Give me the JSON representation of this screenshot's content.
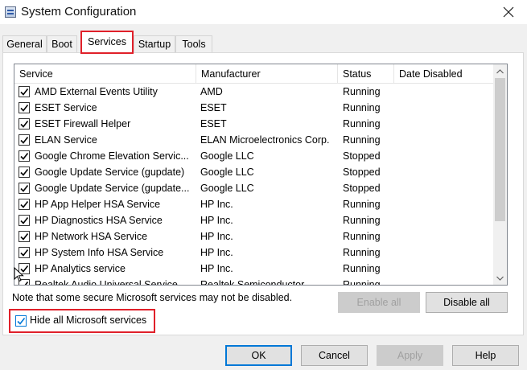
{
  "window": {
    "title": "System Configuration"
  },
  "tabs": [
    {
      "label": "General"
    },
    {
      "label": "Boot"
    },
    {
      "label": "Services"
    },
    {
      "label": "Startup"
    },
    {
      "label": "Tools"
    }
  ],
  "active_tab": "Services",
  "table": {
    "columns": [
      "Service",
      "Manufacturer",
      "Status",
      "Date Disabled"
    ],
    "rows": [
      {
        "checked": true,
        "service": "AMD External Events Utility",
        "manufacturer": "AMD",
        "status": "Running",
        "date_disabled": ""
      },
      {
        "checked": true,
        "service": "ESET Service",
        "manufacturer": "ESET",
        "status": "Running",
        "date_disabled": ""
      },
      {
        "checked": true,
        "service": "ESET Firewall Helper",
        "manufacturer": "ESET",
        "status": "Running",
        "date_disabled": ""
      },
      {
        "checked": true,
        "service": "ELAN Service",
        "manufacturer": "ELAN Microelectronics Corp.",
        "status": "Running",
        "date_disabled": ""
      },
      {
        "checked": true,
        "service": "Google Chrome Elevation Servic...",
        "manufacturer": "Google LLC",
        "status": "Stopped",
        "date_disabled": ""
      },
      {
        "checked": true,
        "service": "Google Update Service (gupdate)",
        "manufacturer": "Google LLC",
        "status": "Stopped",
        "date_disabled": ""
      },
      {
        "checked": true,
        "service": "Google Update Service (gupdate...",
        "manufacturer": "Google LLC",
        "status": "Stopped",
        "date_disabled": ""
      },
      {
        "checked": true,
        "service": "HP App Helper HSA Service",
        "manufacturer": "HP Inc.",
        "status": "Running",
        "date_disabled": ""
      },
      {
        "checked": true,
        "service": "HP Diagnostics HSA Service",
        "manufacturer": "HP Inc.",
        "status": "Running",
        "date_disabled": ""
      },
      {
        "checked": true,
        "service": "HP Network HSA Service",
        "manufacturer": "HP Inc.",
        "status": "Running",
        "date_disabled": ""
      },
      {
        "checked": true,
        "service": "HP System Info HSA Service",
        "manufacturer": "HP Inc.",
        "status": "Running",
        "date_disabled": ""
      },
      {
        "checked": true,
        "service": "HP Analytics service",
        "manufacturer": "HP Inc.",
        "status": "Running",
        "date_disabled": ""
      },
      {
        "checked": true,
        "service": "Realtek Audio Universal Service",
        "manufacturer": "Realtek Semiconductor",
        "status": "Running",
        "date_disabled": ""
      }
    ]
  },
  "note": "Note that some secure Microsoft services may not be disabled.",
  "buttons": {
    "enable_all": "Enable all",
    "disable_all": "Disable all",
    "ok": "OK",
    "cancel": "Cancel",
    "apply": "Apply",
    "help": "Help"
  },
  "hide_ms": {
    "label": "Hide all Microsoft services",
    "checked": true
  },
  "colors": {
    "highlight": "#e0202a",
    "focus": "#0078d7"
  },
  "icons": {
    "close": "close-icon",
    "checkbox": "checkmark-icon",
    "scroll_up": "chevron-up-icon",
    "scroll_down": "chevron-down-icon"
  }
}
